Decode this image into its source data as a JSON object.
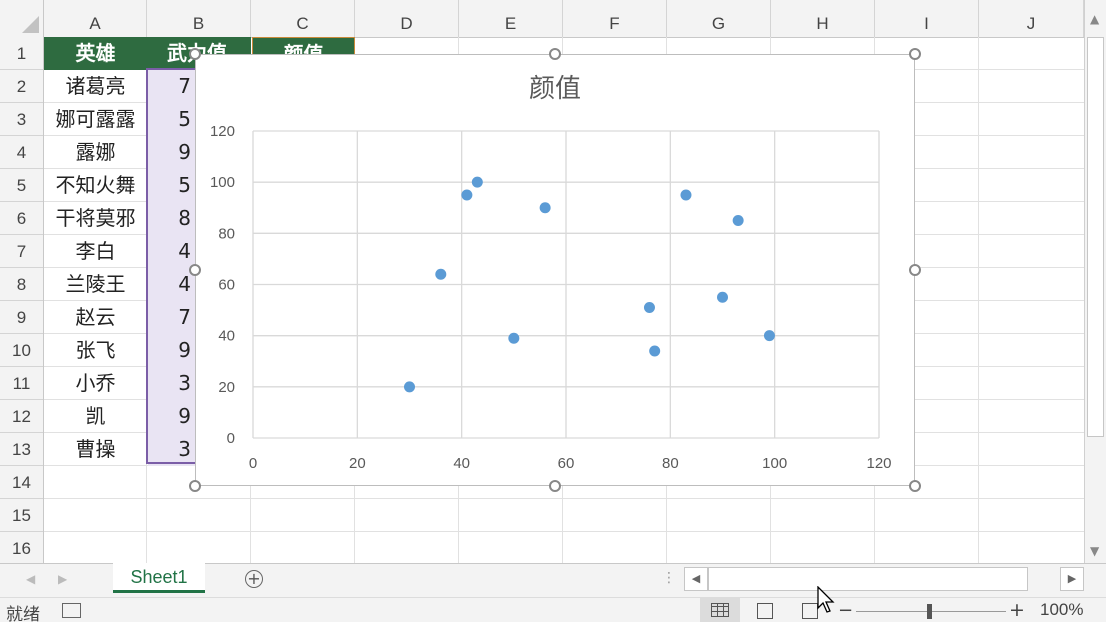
{
  "columns": [
    "A",
    "B",
    "C",
    "D",
    "E",
    "F",
    "G",
    "H",
    "I",
    "J"
  ],
  "rows": [
    "1",
    "2",
    "3",
    "4",
    "5",
    "6",
    "7",
    "8",
    "9",
    "10",
    "11",
    "12",
    "13",
    "14",
    "15",
    "16"
  ],
  "header": {
    "A": "英雄",
    "B": "武力值",
    "C": "颜值"
  },
  "names": [
    "诸葛亮",
    "娜可露露",
    "露娜",
    "不知火舞",
    "干将莫邪",
    "李白",
    "兰陵王",
    "赵云",
    "张飞",
    "小乔",
    "凯",
    "曹操"
  ],
  "col_b_partial": [
    "7",
    "5",
    "9",
    "5",
    "8",
    "4",
    "4",
    "7",
    "9",
    "3",
    "9",
    "3"
  ],
  "sheet_tab": "Sheet1",
  "status_ready": "就绪",
  "zoom_label": "100%",
  "colors": {
    "accent": "#217346",
    "header_fill": "#2e6b40",
    "series": "#5b9bd5",
    "selection": "#7b5ea7"
  },
  "chart_data": {
    "type": "scatter",
    "title": "颜值",
    "xlim": [
      0,
      120
    ],
    "ylim": [
      0,
      120
    ],
    "xticks": [
      "0",
      "20",
      "40",
      "60",
      "80",
      "100",
      "120"
    ],
    "yticks": [
      "0",
      "20",
      "40",
      "60",
      "80",
      "100",
      "120"
    ],
    "grid": true,
    "points": [
      {
        "x": 30,
        "y": 20
      },
      {
        "x": 36,
        "y": 64
      },
      {
        "x": 41,
        "y": 95
      },
      {
        "x": 43,
        "y": 100
      },
      {
        "x": 50,
        "y": 39
      },
      {
        "x": 56,
        "y": 90
      },
      {
        "x": 76,
        "y": 51
      },
      {
        "x": 77,
        "y": 34
      },
      {
        "x": 83,
        "y": 95
      },
      {
        "x": 90,
        "y": 55
      },
      {
        "x": 93,
        "y": 85
      },
      {
        "x": 99,
        "y": 40
      }
    ]
  }
}
